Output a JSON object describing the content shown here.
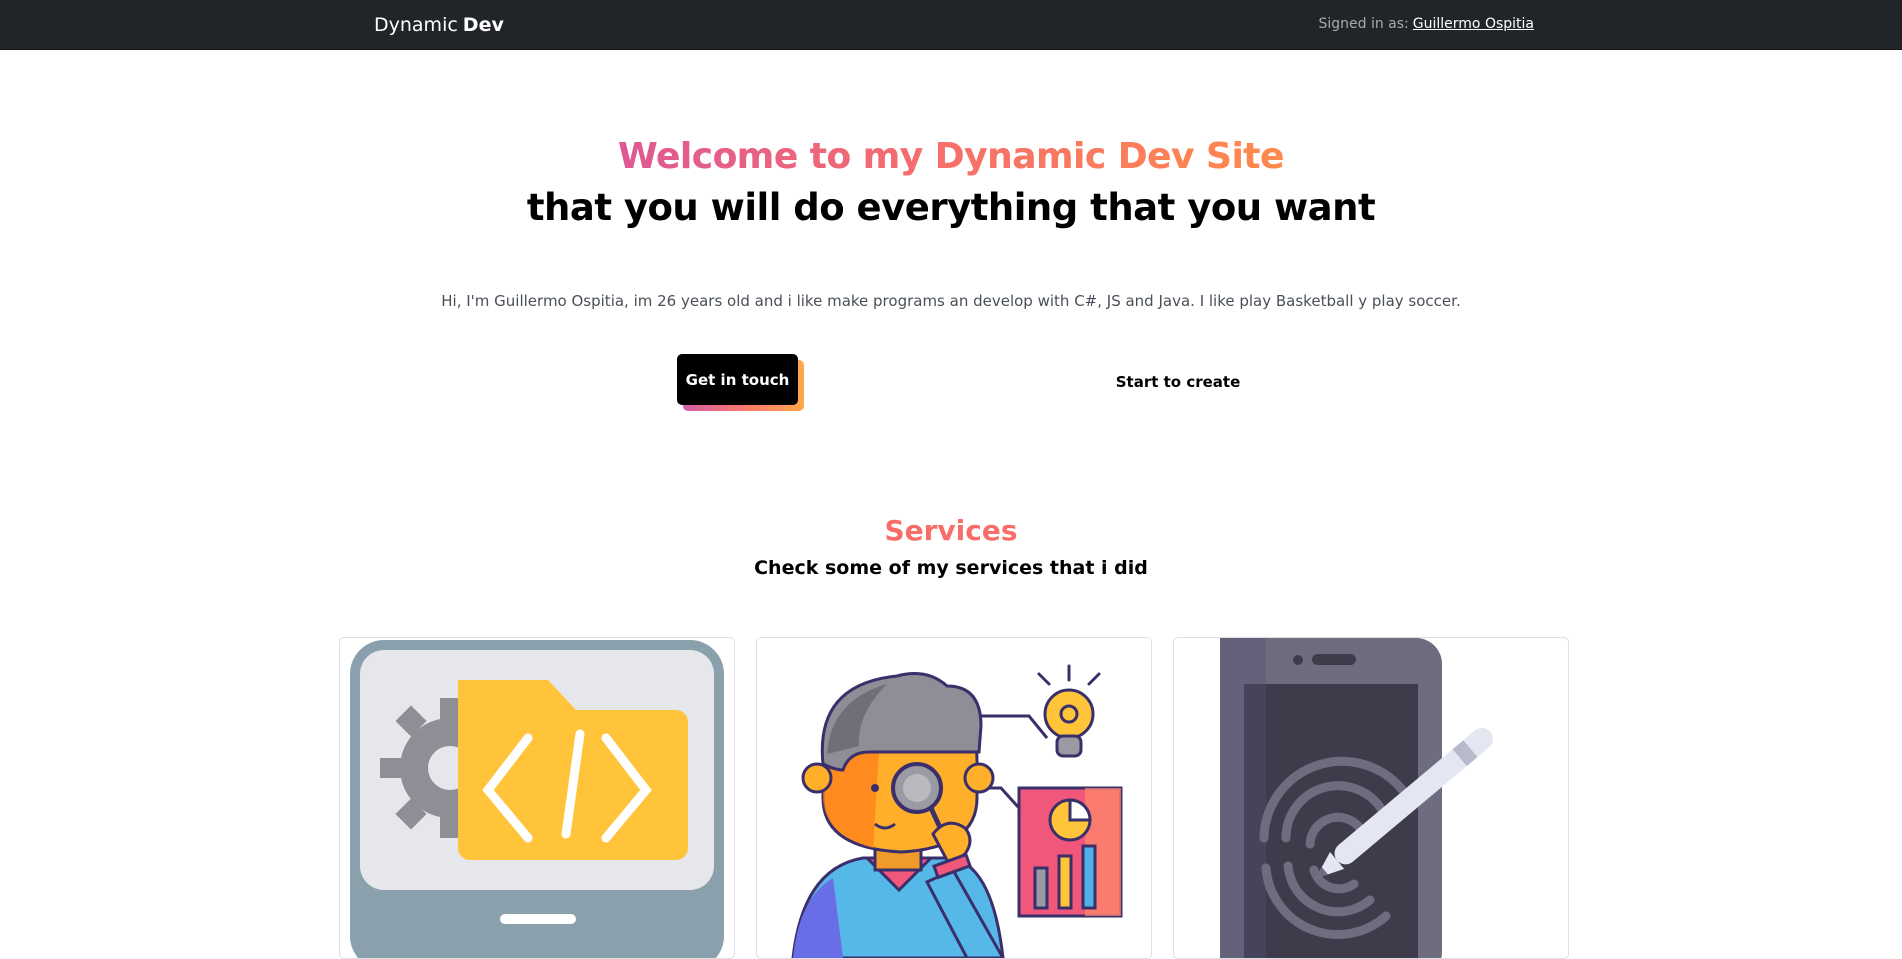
{
  "navbar": {
    "brand_prefix": "Dynamic",
    "brand_bold": "Dev",
    "signed_in_label": "Signed in as:",
    "user_name": "Guillermo Ospitia"
  },
  "hero": {
    "title": "Welcome to my Dynamic Dev Site",
    "subtitle": "that you will do everything that you want",
    "paragraph": "Hi, I'm Guillermo Ospitia, im 26 years old and i like make programs an develop with C#, JS and Java. I like play Basketball y play soccer.",
    "primary_button": "Get in touch",
    "secondary_button": "Start to create"
  },
  "services": {
    "title": "Services",
    "subtitle": "Check some of my services that i did",
    "cards": [
      {
        "icon": "code-folder-monitor-icon"
      },
      {
        "icon": "analyst-person-icon"
      },
      {
        "icon": "phone-fingerprint-pen-icon"
      }
    ]
  },
  "colors": {
    "navbar_bg": "#212529",
    "gradient_start": "#de5895",
    "gradient_end": "#ff8a4c"
  }
}
